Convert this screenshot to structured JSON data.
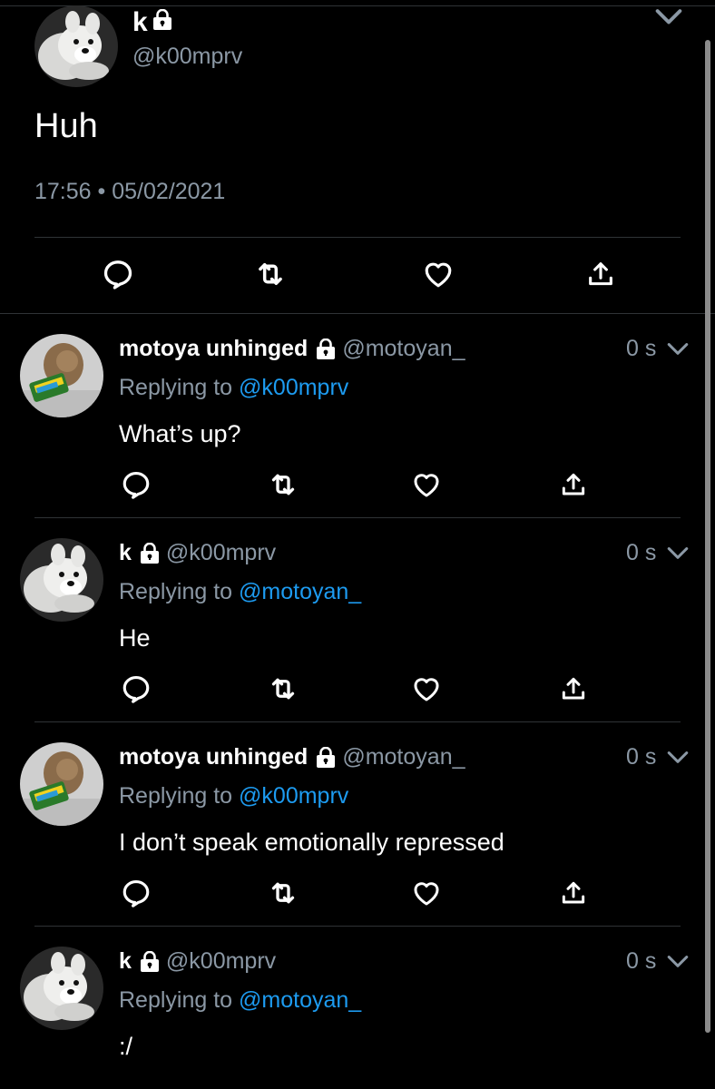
{
  "main_tweet": {
    "display_name": "k",
    "handle": "@k00mprv",
    "text": "Huh",
    "timestamp": "17:56 • 05/02/2021"
  },
  "replies": [
    {
      "display_name": "motoya unhinged",
      "handle": "@motoyan_",
      "time": "0 s",
      "replying_prefix": "Replying to ",
      "replying_to": "@k00mprv",
      "text": "What’s up?",
      "avatar": "toy-avatar"
    },
    {
      "display_name": "k",
      "handle": "@k00mprv",
      "time": "0 s",
      "replying_prefix": "Replying to ",
      "replying_to": "@motoyan_",
      "text": "He",
      "avatar": "dog-avatar"
    },
    {
      "display_name": "motoya unhinged",
      "handle": "@motoyan_",
      "time": "0 s",
      "replying_prefix": "Replying to ",
      "replying_to": "@k00mprv",
      "text": "I don’t speak emotionally repressed",
      "avatar": "toy-avatar"
    },
    {
      "display_name": "k",
      "handle": "@k00mprv",
      "time": "0 s",
      "replying_prefix": "Replying to ",
      "replying_to": "@motoyan_",
      "text": ":/",
      "avatar": "dog-avatar"
    }
  ],
  "icons": {
    "reply": "reply-icon",
    "retweet": "retweet-icon",
    "like": "like-icon",
    "share": "share-icon",
    "lock": "lock-icon",
    "more": "chevron-down-icon"
  },
  "colors": {
    "background": "#000000",
    "text": "#ffffff",
    "muted": "#8b98a5",
    "mention": "#1d9bf0",
    "divider": "#2f3336"
  }
}
